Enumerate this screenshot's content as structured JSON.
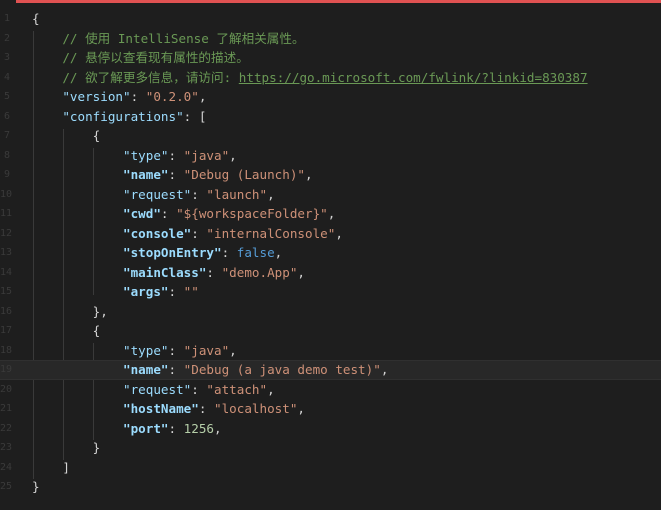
{
  "editor": {
    "lines": [
      {
        "num": "1",
        "segments": [
          {
            "t": "{",
            "c": "pun"
          }
        ]
      },
      {
        "num": "2",
        "segments": [
          {
            "t": "    // 使用 IntelliSense 了解相关属性。",
            "c": "cmt"
          }
        ]
      },
      {
        "num": "3",
        "segments": [
          {
            "t": "    // 悬停以查看现有属性的描述。",
            "c": "cmt"
          }
        ]
      },
      {
        "num": "4",
        "segments": [
          {
            "t": "    // 欲了解更多信息，请访问: ",
            "c": "cmt"
          },
          {
            "t": "https://go.microsoft.com/fwlink/?linkid=830387",
            "c": "url"
          }
        ]
      },
      {
        "num": "5",
        "segments": [
          {
            "t": "    ",
            "c": "pun"
          },
          {
            "t": "\"version\"",
            "c": "key"
          },
          {
            "t": ": ",
            "c": "pun"
          },
          {
            "t": "\"0.2.0\"",
            "c": "str"
          },
          {
            "t": ",",
            "c": "pun"
          }
        ]
      },
      {
        "num": "6",
        "segments": [
          {
            "t": "    ",
            "c": "pun"
          },
          {
            "t": "\"configurations\"",
            "c": "key"
          },
          {
            "t": ": [",
            "c": "pun"
          }
        ]
      },
      {
        "num": "7",
        "segments": [
          {
            "t": "        {",
            "c": "pun"
          }
        ]
      },
      {
        "num": "8",
        "segments": [
          {
            "t": "            ",
            "c": "pun"
          },
          {
            "t": "\"type\"",
            "c": "key"
          },
          {
            "t": ": ",
            "c": "pun"
          },
          {
            "t": "\"java\"",
            "c": "str"
          },
          {
            "t": ",",
            "c": "pun"
          }
        ]
      },
      {
        "num": "9",
        "segments": [
          {
            "t": "            ",
            "c": "pun"
          },
          {
            "t": "\"name\"",
            "c": "key-b"
          },
          {
            "t": ": ",
            "c": "pun"
          },
          {
            "t": "\"Debug (Launch)\"",
            "c": "str"
          },
          {
            "t": ",",
            "c": "pun"
          }
        ]
      },
      {
        "num": "10",
        "segments": [
          {
            "t": "            ",
            "c": "pun"
          },
          {
            "t": "\"request\"",
            "c": "key"
          },
          {
            "t": ": ",
            "c": "pun"
          },
          {
            "t": "\"launch\"",
            "c": "str"
          },
          {
            "t": ",",
            "c": "pun"
          }
        ]
      },
      {
        "num": "11",
        "segments": [
          {
            "t": "            ",
            "c": "pun"
          },
          {
            "t": "\"cwd\"",
            "c": "key-b"
          },
          {
            "t": ": ",
            "c": "pun"
          },
          {
            "t": "\"${workspaceFolder}\"",
            "c": "str"
          },
          {
            "t": ",",
            "c": "pun"
          }
        ]
      },
      {
        "num": "12",
        "segments": [
          {
            "t": "            ",
            "c": "pun"
          },
          {
            "t": "\"console\"",
            "c": "key-b"
          },
          {
            "t": ": ",
            "c": "pun"
          },
          {
            "t": "\"internalConsole\"",
            "c": "str"
          },
          {
            "t": ",",
            "c": "pun"
          }
        ]
      },
      {
        "num": "13",
        "segments": [
          {
            "t": "            ",
            "c": "pun"
          },
          {
            "t": "\"stopOnEntry\"",
            "c": "key-b"
          },
          {
            "t": ": ",
            "c": "pun"
          },
          {
            "t": "false",
            "c": "kw"
          },
          {
            "t": ",",
            "c": "pun"
          }
        ]
      },
      {
        "num": "14",
        "segments": [
          {
            "t": "            ",
            "c": "pun"
          },
          {
            "t": "\"mainClass\"",
            "c": "key-b"
          },
          {
            "t": ": ",
            "c": "pun"
          },
          {
            "t": "\"demo.App\"",
            "c": "str"
          },
          {
            "t": ",",
            "c": "pun"
          }
        ]
      },
      {
        "num": "15",
        "segments": [
          {
            "t": "            ",
            "c": "pun"
          },
          {
            "t": "\"args\"",
            "c": "key-b"
          },
          {
            "t": ": ",
            "c": "pun"
          },
          {
            "t": "\"\"",
            "c": "str"
          }
        ]
      },
      {
        "num": "16",
        "segments": [
          {
            "t": "        },",
            "c": "pun"
          }
        ]
      },
      {
        "num": "17",
        "segments": [
          {
            "t": "        {",
            "c": "pun"
          }
        ]
      },
      {
        "num": "18",
        "segments": [
          {
            "t": "            ",
            "c": "pun"
          },
          {
            "t": "\"type\"",
            "c": "key"
          },
          {
            "t": ": ",
            "c": "pun"
          },
          {
            "t": "\"java\"",
            "c": "str"
          },
          {
            "t": ",",
            "c": "pun"
          }
        ]
      },
      {
        "num": "19",
        "active": true,
        "segments": [
          {
            "t": "            ",
            "c": "pun"
          },
          {
            "t": "\"name\"",
            "c": "key-b"
          },
          {
            "t": ": ",
            "c": "pun"
          },
          {
            "t": "\"Debug (a java demo test)\"",
            "c": "str"
          },
          {
            "t": ",",
            "c": "pun"
          }
        ]
      },
      {
        "num": "20",
        "segments": [
          {
            "t": "            ",
            "c": "pun"
          },
          {
            "t": "\"request\"",
            "c": "key"
          },
          {
            "t": ": ",
            "c": "pun"
          },
          {
            "t": "\"attach\"",
            "c": "str"
          },
          {
            "t": ",",
            "c": "pun"
          }
        ]
      },
      {
        "num": "21",
        "segments": [
          {
            "t": "            ",
            "c": "pun"
          },
          {
            "t": "\"hostName\"",
            "c": "key-b"
          },
          {
            "t": ": ",
            "c": "pun"
          },
          {
            "t": "\"localhost\"",
            "c": "str"
          },
          {
            "t": ",",
            "c": "pun"
          }
        ]
      },
      {
        "num": "22",
        "segments": [
          {
            "t": "            ",
            "c": "pun"
          },
          {
            "t": "\"port\"",
            "c": "key-b"
          },
          {
            "t": ": ",
            "c": "pun"
          },
          {
            "t": "1256",
            "c": "num"
          },
          {
            "t": ",",
            "c": "pun"
          }
        ]
      },
      {
        "num": "23",
        "segments": [
          {
            "t": "        }",
            "c": "pun"
          }
        ]
      },
      {
        "num": "24",
        "segments": [
          {
            "t": "    ]",
            "c": "pun"
          }
        ]
      },
      {
        "num": "25",
        "segments": [
          {
            "t": "}",
            "c": "pun"
          }
        ]
      }
    ]
  },
  "colors": {
    "background": "#1e1e1e",
    "comment": "#6a9955",
    "property": "#9cdcfe",
    "string": "#ce9178",
    "number": "#b5cea8",
    "keyword": "#569cd6"
  }
}
